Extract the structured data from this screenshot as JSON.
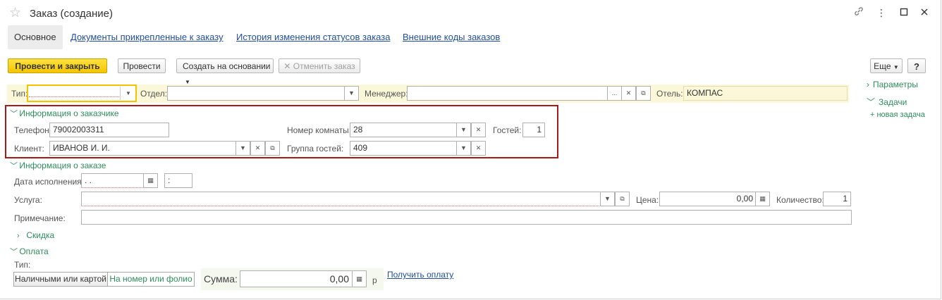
{
  "window": {
    "title": "Заказ (создание)"
  },
  "tabs": [
    "Основное",
    "Документы прикрепленные к заказу",
    "История изменения статусов заказа",
    "Внешние коды заказов"
  ],
  "toolbar": {
    "post_close": "Провести и закрыть",
    "post": "Провести",
    "create_based": "Создать на основании",
    "cancel_order": "Отменить заказ",
    "more": "Еще",
    "help": "?"
  },
  "header_fields": {
    "type_label": "Тип:",
    "type_value": "",
    "dept_label": "Отдел:",
    "dept_value": "",
    "manager_label": "Менеджер:",
    "manager_value": "",
    "hotel_label": "Отель:",
    "hotel_value": "КОМПАС"
  },
  "customer": {
    "title": "Информация о заказчике",
    "phone_label": "Телефон:",
    "phone_value": "79002003311",
    "client_label": "Клиент:",
    "client_value": "ИВАНОВ И. И.",
    "room_label": "Номер комнаты:",
    "room_value": "28",
    "guests_label": "Гостей:",
    "guests_value": "1",
    "group_label": "Группа гостей:",
    "group_value": "409"
  },
  "order": {
    "title": "Информация о заказе",
    "date_label": "Дата исполнения:",
    "date_value": " .  .",
    "time_value": " :",
    "service_label": "Услуга:",
    "service_value": "",
    "price_label": "Цена:",
    "price_value": "0,00",
    "qty_label": "Количество:",
    "qty_value": "1",
    "note_label": "Примечание:",
    "note_value": "",
    "discount": "Скидка"
  },
  "payment": {
    "title": "Оплата",
    "type_label": "Тип:",
    "opt_cash": "Наличными или картой",
    "opt_room": "На номер или фолио",
    "sum_label": "Сумма:",
    "sum_value": "0,00",
    "currency": "р",
    "receive_link": "Получить оплату"
  },
  "side": {
    "params": "Параметры",
    "tasks": "Задачи",
    "new_task": "+ новая задача"
  }
}
